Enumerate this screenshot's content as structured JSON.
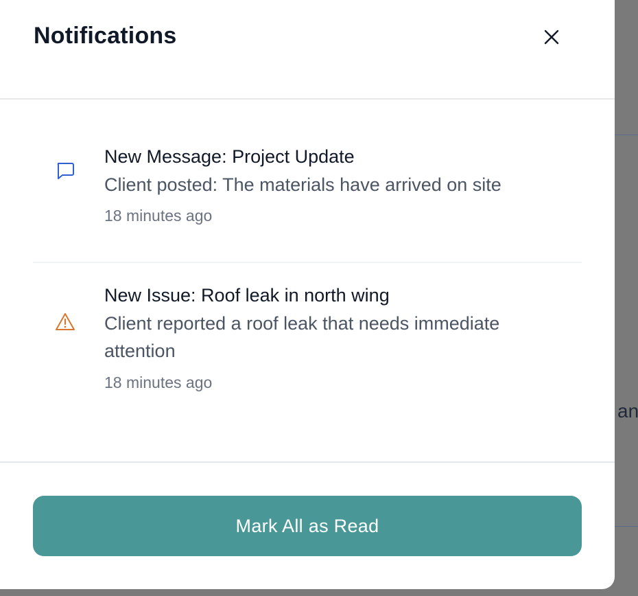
{
  "background": {
    "partial_text": "an"
  },
  "panel": {
    "title": "Notifications",
    "close_icon": "close-icon"
  },
  "notifications": [
    {
      "icon": "message-icon",
      "icon_color": "#2f5fd0",
      "title": "New Message: Project Update",
      "description": "Client posted: The materials have arrived on site",
      "time": "18 minutes ago"
    },
    {
      "icon": "warning-icon",
      "icon_color": "#d9762e",
      "title": "New Issue: Roof leak in north wing",
      "description": "Client reported a roof leak that needs immediate attention",
      "time": "18 minutes ago"
    }
  ],
  "footer": {
    "mark_all_label": "Mark All as Read",
    "button_color": "#4a9797"
  }
}
